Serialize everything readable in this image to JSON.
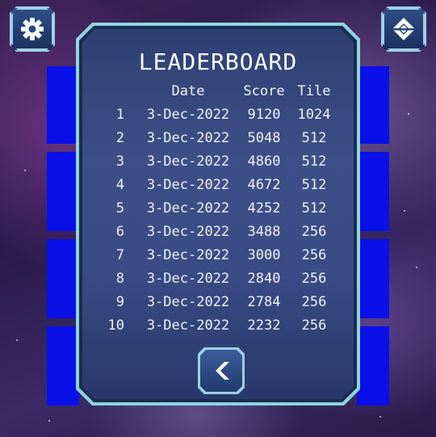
{
  "background_title": "",
  "leaderboard": {
    "title": "LEADERBOARD",
    "columns": {
      "rank": "",
      "date": "Date",
      "score": "Score",
      "tile": "Tile"
    },
    "rows": [
      {
        "rank": "1",
        "date": "3-Dec-2022",
        "score": "9120",
        "tile": "1024"
      },
      {
        "rank": "2",
        "date": "3-Dec-2022",
        "score": "5048",
        "tile": "512"
      },
      {
        "rank": "3",
        "date": "3-Dec-2022",
        "score": "4860",
        "tile": "512"
      },
      {
        "rank": "4",
        "date": "3-Dec-2022",
        "score": "4672",
        "tile": "512"
      },
      {
        "rank": "5",
        "date": "3-Dec-2022",
        "score": "4252",
        "tile": "512"
      },
      {
        "rank": "6",
        "date": "3-Dec-2022",
        "score": "3488",
        "tile": "256"
      },
      {
        "rank": "7",
        "date": "3-Dec-2022",
        "score": "3000",
        "tile": "256"
      },
      {
        "rank": "8",
        "date": "3-Dec-2022",
        "score": "2840",
        "tile": "256"
      },
      {
        "rank": "9",
        "date": "3-Dec-2022",
        "score": "2784",
        "tile": "256"
      },
      {
        "rank": "10",
        "date": "3-Dec-2022",
        "score": "2232",
        "tile": "256"
      }
    ]
  },
  "buttons": {
    "settings_icon": "gear-icon",
    "menu_icon": "diamond-logo-icon",
    "back_icon": "chevron-left-icon"
  },
  "colors": {
    "tile_blue": "#0a10e8",
    "panel_border": "#8fd4e0",
    "panel_fill": "#3d4f88",
    "text": "#ffffff"
  }
}
